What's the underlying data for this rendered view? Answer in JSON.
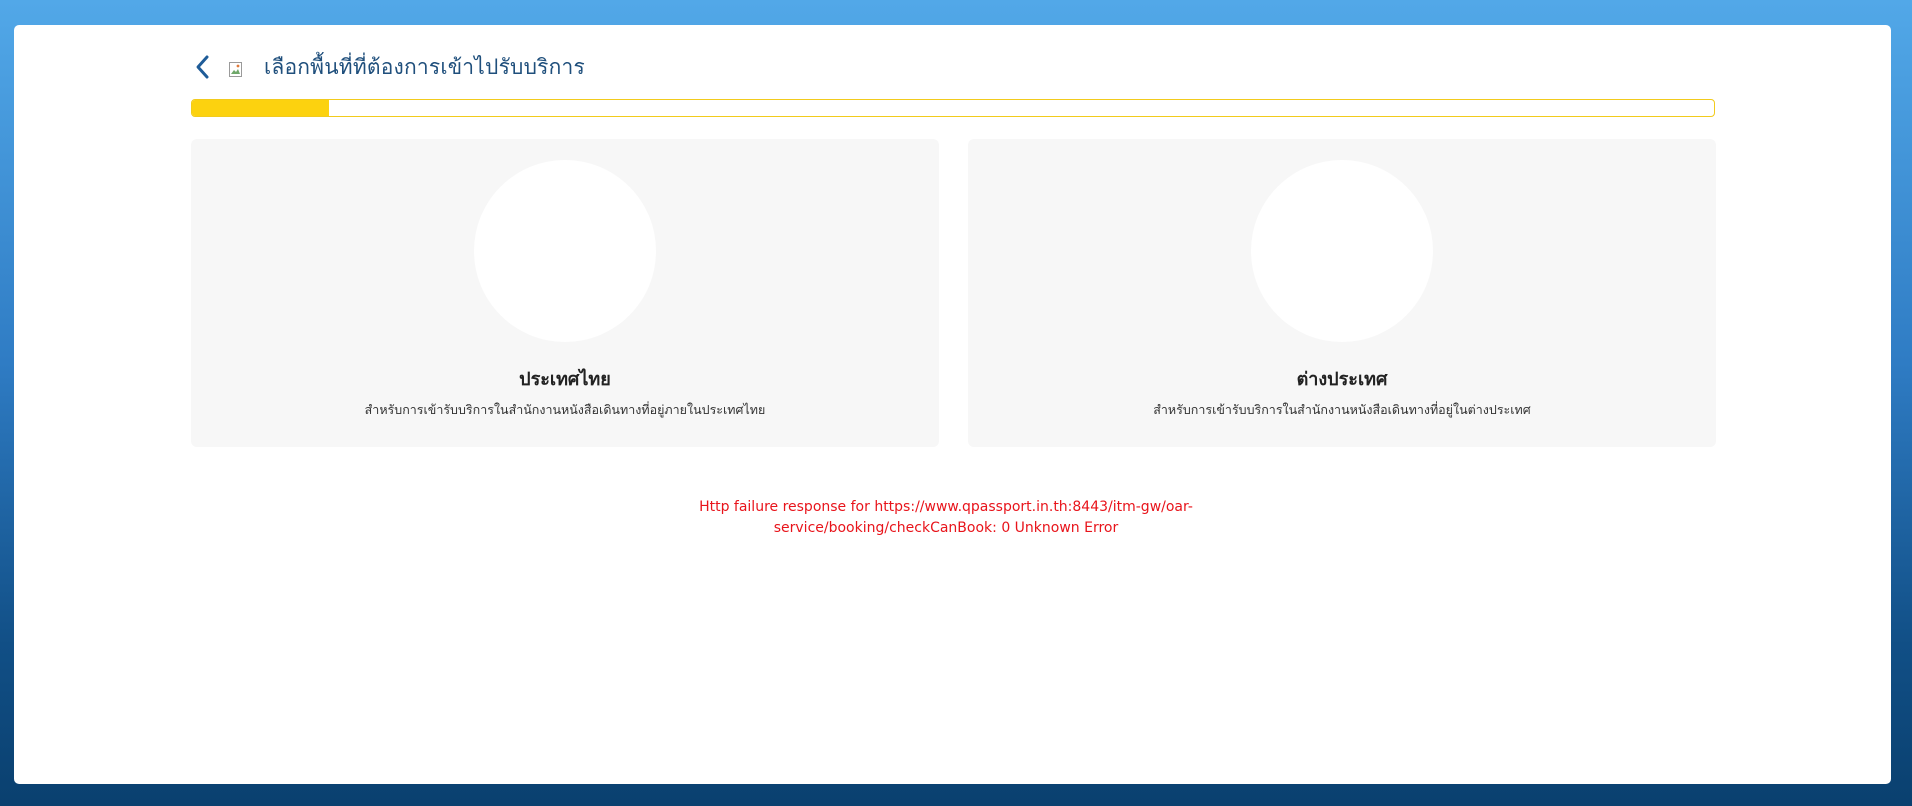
{
  "header": {
    "back_icon": "chevron-left-icon",
    "image_icon": "broken-image-icon",
    "title": "เลือกพื้นที่ที่ต้องการเข้าไปรับบริการ"
  },
  "progress": {
    "value_percent": 9,
    "color": "#fcd20f"
  },
  "options": [
    {
      "title": "ประเทศไทย",
      "description": "สำหรับการเข้ารับบริการในสำนักงานหนังสือเดินทางที่อยู่ภายในประเทศไทย"
    },
    {
      "title": "ต่างประเทศ",
      "description": "สำหรับการเข้ารับบริการในสำนักงานหนังสือเดินทางที่อยู่ในต่างประเทศ"
    }
  ],
  "error": {
    "message": "Http failure response for https://www.qpassport.in.th:8443/itm-gw/oar-service/booking/checkCanBook: 0 Unknown Error",
    "color": "#e8141b"
  }
}
